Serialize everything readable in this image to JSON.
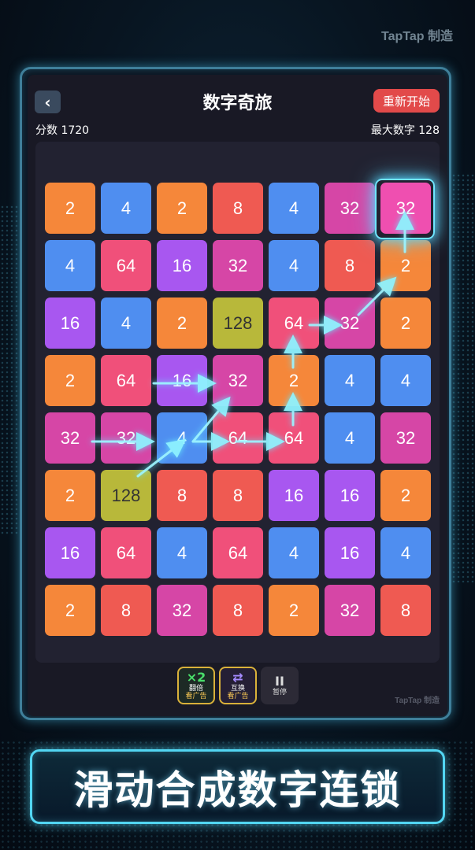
{
  "watermark": "TapTap 制造",
  "header": {
    "back_icon": "‹",
    "title": "数字奇旅",
    "restart_label": "重新开始",
    "score": "分数 1720",
    "max_number": "最大数字 128"
  },
  "board": {
    "rows": [
      [
        2,
        4,
        2,
        8,
        4,
        32,
        32
      ],
      [
        4,
        64,
        16,
        32,
        4,
        8,
        2
      ],
      [
        16,
        4,
        2,
        128,
        64,
        32,
        2
      ],
      [
        2,
        64,
        16,
        32,
        2,
        4,
        4
      ],
      [
        32,
        32,
        4,
        64,
        64,
        4,
        32
      ],
      [
        2,
        128,
        8,
        8,
        16,
        16,
        2
      ],
      [
        16,
        64,
        4,
        64,
        4,
        16,
        4
      ],
      [
        2,
        8,
        32,
        8,
        2,
        32,
        8
      ]
    ],
    "colors": {
      "2": "#f5873a",
      "4": "#4f8ef0",
      "8": "#ef5a52",
      "16": "#a857f0",
      "32": "#d646a6",
      "64": "#f0507a",
      "128": "#b8b83a"
    },
    "selected_color": "#ef4fb0"
  },
  "toolbar": {
    "double": {
      "icon": "×2",
      "label": "翻倍",
      "sub": "看广告"
    },
    "swap": {
      "icon": "⇄",
      "label": "互换",
      "sub": "看广告"
    },
    "pause": {
      "icon": "II",
      "label": "暂停"
    }
  },
  "inner_watermark": "TapTap 制造",
  "banner": {
    "text": "滑动合成数字连锁"
  }
}
